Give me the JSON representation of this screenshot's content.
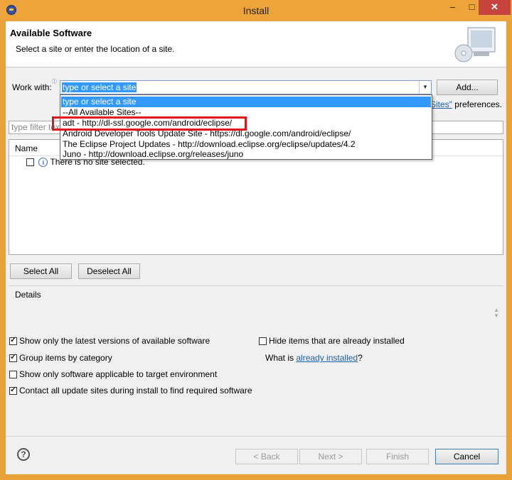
{
  "window": {
    "title": "Install"
  },
  "header": {
    "title": "Available Software",
    "description": "Select a site or enter the location of a site."
  },
  "work_with": {
    "label": "Work with:",
    "value": "type or select a site",
    "add_label": "Add...",
    "options": [
      "type or select a site",
      "--All Available Sites--",
      "adt - http://dl-ssl.google.com/android/eclipse/",
      "Android Developer Tools Update Site - https://dl.google.com/android/eclipse/",
      "The Eclipse Project Updates - http://download.eclipse.org/eclipse/updates/4.2",
      "Juno - http://download.eclipse.org/releases/juno"
    ]
  },
  "sites_pref": {
    "link": "Sites\"",
    "text": "preferences."
  },
  "filter": {
    "placeholder": "type filter text"
  },
  "tree": {
    "column": "Name",
    "empty_message": "There is no site selected."
  },
  "buttons": {
    "select_all": "Select All",
    "deselect_all": "Deselect All"
  },
  "details": {
    "label": "Details"
  },
  "options": {
    "latest_versions": "Show only the latest versions of available software",
    "group_by_category": "Group items by category",
    "target_env": "Show only software applicable to target environment",
    "contact_sites": "Contact all update sites during install to find required software",
    "hide_installed": "Hide items that are already installed",
    "what_is": "What is",
    "already_installed": "already installed",
    "question": "?"
  },
  "footer": {
    "back": "< Back",
    "next": "Next >",
    "finish": "Finish",
    "cancel": "Cancel"
  },
  "colors": {
    "accent": "#3399ff",
    "highlight": "#e0161c",
    "titlebar": "#eda53b"
  }
}
